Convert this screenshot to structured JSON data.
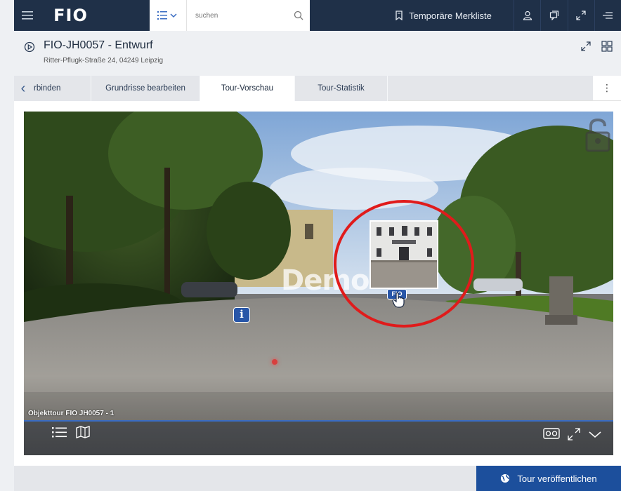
{
  "topbar": {
    "menu_icon": "hamburger-icon",
    "logo": "FIO",
    "search_placeholder": "suchen",
    "merkliste_label": "Temporäre Merkliste"
  },
  "title": {
    "text": "FIO-JH0057 - Entwurf",
    "address": "Ritter-Pflugk-Straße 24, 04249 Leipzig"
  },
  "tabs": {
    "items": [
      {
        "label": "rbinden"
      },
      {
        "label": "Grundrisse bearbeiten"
      },
      {
        "label": "Tour-Vorschau"
      },
      {
        "label": "Tour-Statistik"
      }
    ],
    "active": "Tour-Vorschau"
  },
  "viewer": {
    "watermark": "Demo",
    "info_hotspot": "i",
    "fio_badge": "FIO",
    "tour_label": "Objekttour FIO JH0057 - 1"
  },
  "footer": {
    "publish_label": "Tour veröffentlichen"
  },
  "colors": {
    "topbar": "#1f3048",
    "accent": "#1c4f9c",
    "highlight_circle": "#e01b1b"
  }
}
